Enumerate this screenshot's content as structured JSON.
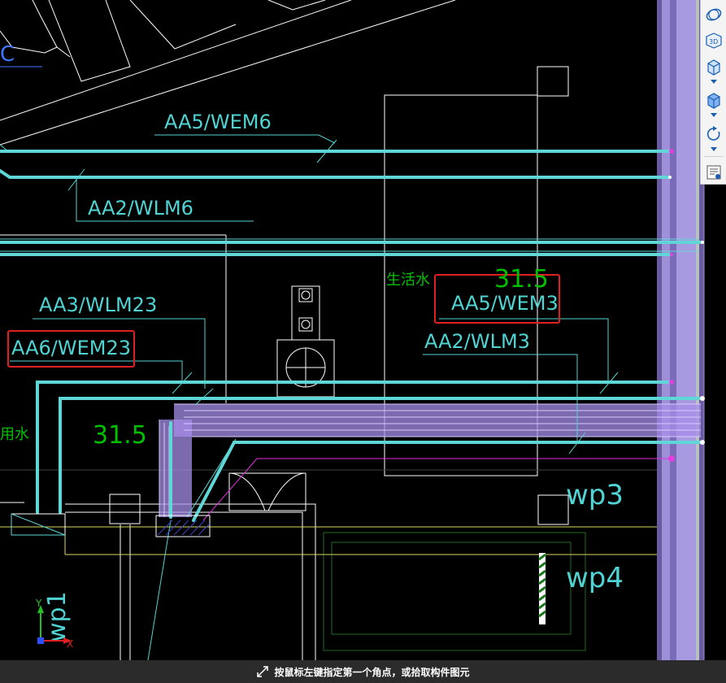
{
  "drawing": {
    "labels": {
      "aa5_wem6": "AA5/WEM6",
      "aa2_wlm6": "AA2/WLM6",
      "aa3_wlm23": "AA3/WLM23",
      "aa6_wem23": "AA6/WEM23",
      "aa5_wem3": "AA5/WEM3",
      "aa2_wlm3": "AA2/WLM3",
      "dim_left": "31.5",
      "dim_right": "31.5",
      "water_right": "生活水",
      "water_left": "用水",
      "wp1": "wp1",
      "wp3": "wp3",
      "wp4": "wp4",
      "partial_c": "C"
    },
    "colors": {
      "background": "#000000",
      "cable": "#5fd7d7",
      "label": "#4fd3d3",
      "dimension": "#00c000",
      "selection": "#9370db",
      "highlight_box": "#e02020",
      "wall": "#ffffff",
      "yellow_line": "#d8d860",
      "magenta_line": "#e030e0"
    },
    "axes": {
      "x_label": "X",
      "y_label": "Y"
    }
  },
  "toolbar": {
    "items": [
      {
        "name": "orbit-icon"
      },
      {
        "name": "3d-view-icon",
        "label": "3D"
      },
      {
        "name": "cube-view-icon"
      },
      {
        "name": "cube-solid-icon"
      },
      {
        "name": "rotate-icon"
      },
      {
        "name": "layer-properties-icon"
      }
    ]
  },
  "status": {
    "prompt": "按鼠标左键指定第一个角点，或拾取构件图元"
  }
}
